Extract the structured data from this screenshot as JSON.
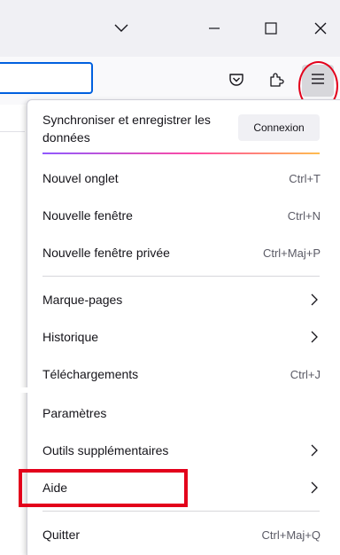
{
  "menu": {
    "sync_text": "Synchroniser et enregistrer les données",
    "connect_label": "Connexion",
    "items": [
      {
        "label": "Nouvel onglet",
        "shortcut": "Ctrl+T"
      },
      {
        "label": "Nouvelle fenêtre",
        "shortcut": "Ctrl+N"
      },
      {
        "label": "Nouvelle fenêtre privée",
        "shortcut": "Ctrl+Maj+P"
      },
      {
        "label": "Marque-pages",
        "shortcut": ""
      },
      {
        "label": "Historique",
        "shortcut": ""
      },
      {
        "label": "Téléchargements",
        "shortcut": "Ctrl+J"
      },
      {
        "label": "Paramètres",
        "shortcut": ""
      },
      {
        "label": "Outils supplémentaires",
        "shortcut": ""
      },
      {
        "label": "Aide",
        "shortcut": ""
      },
      {
        "label": "Quitter",
        "shortcut": "Ctrl+Maj+Q"
      }
    ]
  },
  "icons": {
    "tab_list": "chevron-down-icon",
    "minimize": "minimize-icon",
    "maximize": "maximize-icon",
    "close": "close-icon",
    "pocket": "pocket-icon",
    "extensions": "extensions-icon",
    "app_menu": "hamburger-menu-icon"
  },
  "colors": {
    "annotation": "#e3001b",
    "focus_blue": "#0060df"
  }
}
